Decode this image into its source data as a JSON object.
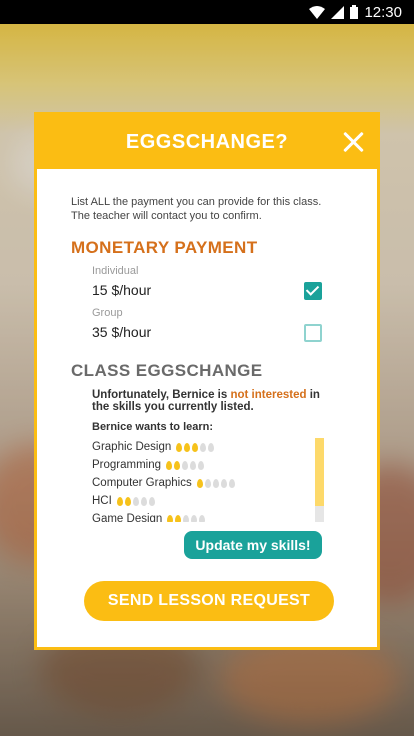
{
  "statusbar": {
    "time": "12:30"
  },
  "dialog": {
    "title": "EGGSCHANGE?",
    "intro": "List ALL the payment you can provide for this class. The teacher will contact you to confirm.",
    "monetary": {
      "title": "MONETARY PAYMENT",
      "options": [
        {
          "label": "Individual",
          "value": "15 $/hour",
          "checked": true
        },
        {
          "label": "Group",
          "value": "35 $/hour",
          "checked": false
        }
      ]
    },
    "class_eggschange": {
      "title": "CLASS EGGSCHANGE",
      "note_prefix": "Unfortunately, Bernice is",
      "note_highlight": "not interested",
      "note_suffix": "in the skills you currently listed.",
      "wants_label": "Bernice wants to learn:",
      "skills": [
        {
          "name": "Graphic Design",
          "level": 3
        },
        {
          "name": "Programming",
          "level": 2
        },
        {
          "name": "Computer Graphics",
          "level": 1
        },
        {
          "name": "HCI",
          "level": 2
        },
        {
          "name": "Game Design",
          "level": 2
        }
      ],
      "scroll_position": 0
    },
    "update_button": "Update my skills!",
    "send_button": "SEND LESSON REQUEST"
  },
  "colors": {
    "primary": "#fbbd13",
    "accent": "#d5701b",
    "teal": "#1aa29a"
  }
}
